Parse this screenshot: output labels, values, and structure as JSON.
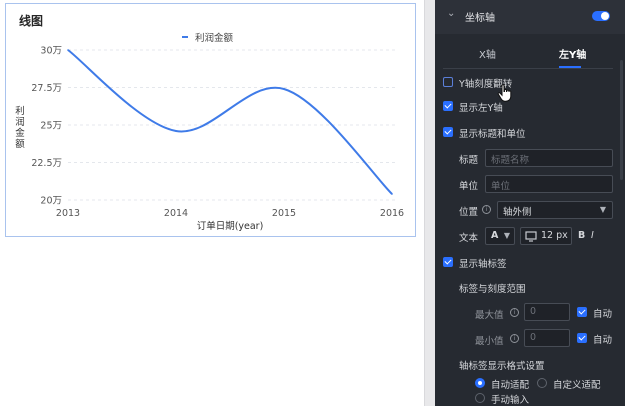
{
  "chart": {
    "title": "线图",
    "legend": "利润金额",
    "ylabel": "利润金额",
    "xlabel": "订单日期(year)"
  },
  "chart_data": {
    "type": "line",
    "categories": [
      "2013",
      "2014",
      "2015",
      "2016"
    ],
    "series": [
      {
        "name": "利润金额",
        "values": [
          300000,
          246000,
          274000,
          204000
        ]
      }
    ],
    "ylim": [
      200000,
      300000
    ],
    "yticks": [
      {
        "value": 300000,
        "label": "30万"
      },
      {
        "value": 275000,
        "label": "27.5万"
      },
      {
        "value": 250000,
        "label": "25万"
      },
      {
        "value": 225000,
        "label": "22.5万"
      },
      {
        "value": 200000,
        "label": "20万"
      }
    ],
    "xlabel": "订单日期(year)",
    "ylabel": "利润金额",
    "smooth": true,
    "grid": "horizontal dashed",
    "legend_position": "top-center",
    "color": "#3f7be8"
  },
  "panel": {
    "section_title": "坐标轴",
    "tabs": [
      "X轴",
      "左Y轴"
    ],
    "active_tab": "左Y轴",
    "flip_y": "Y轴刻度翻转",
    "show_left_y": "显示左Y轴",
    "show_title_unit": "显示标题和单位",
    "title_label": "标题",
    "title_placeholder": "标题名称",
    "unit_label": "单位",
    "unit_placeholder": "单位",
    "position_label": "位置",
    "position_value": "轴外侧",
    "text_label": "文本",
    "font_letter": "A",
    "font_size": "12 px",
    "bold": "B",
    "italic": "I",
    "show_axis_labels": "显示轴标签",
    "range_title": "标签与刻度范围",
    "max_label": "最大值",
    "max_value": "0",
    "min_label": "最小值",
    "min_value": "0",
    "auto_label": "自动",
    "format_title": "轴标签显示格式设置",
    "opt_auto": "自动适配",
    "opt_custom": "自定义适配",
    "opt_manual": "手动输入"
  },
  "colors": {
    "accent": "#2a6fff",
    "line": "#3f7be8",
    "panel_bg": "#262a31"
  }
}
